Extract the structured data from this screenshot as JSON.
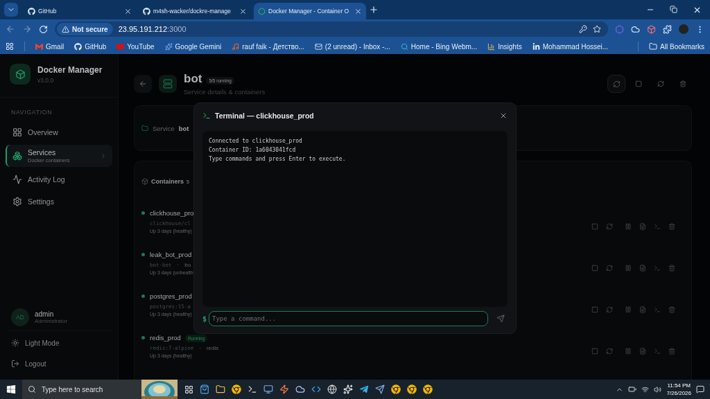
{
  "browser": {
    "tabs": [
      {
        "title": "GitHub",
        "selected": false
      },
      {
        "title": "m4sh-wacker/dockre-manage",
        "selected": false
      },
      {
        "title": "Docker Manager - Container O",
        "selected": true
      }
    ],
    "address": {
      "security": "Not secure",
      "host": "23.95.191.212",
      "port": ":3000"
    },
    "bookmarks": [
      "Gmail",
      "GitHub",
      "YouTube",
      "Google Gemini",
      "rauf faik - Детство...",
      "(2 unread) - Inbox -...",
      "Home - Bing Webm...",
      "Insights",
      "Mohammad Hossei..."
    ],
    "all_bookmarks": "All Bookmarks"
  },
  "sidebar": {
    "app_name": "Docker Manager",
    "version": "v3.0.0",
    "section": "NAVIGATION",
    "items": [
      {
        "label": "Overview",
        "selected": false
      },
      {
        "label": "Services",
        "sublabel": "Docker containers",
        "selected": true
      },
      {
        "label": "Activity Log",
        "selected": false
      },
      {
        "label": "Settings",
        "selected": false
      }
    ],
    "user": {
      "initials": "AD",
      "name": "admin",
      "role": "Administrator"
    },
    "theme_toggle": "Light Mode",
    "logout": "Logout"
  },
  "header": {
    "title": "bot",
    "badge": "5/5 running",
    "subtitle": "Service details & containers"
  },
  "service_card": {
    "label": "Service",
    "value": "bot"
  },
  "containers": {
    "title": "Containers",
    "count": "5",
    "rows": [
      {
        "name": "clickhouse_pro",
        "image": "clickhouse/cl",
        "uptime": "Up 3 days (healthy)"
      },
      {
        "name": "leak_bot_prod",
        "image": "bot-bot",
        "separator": "·",
        "service": "bo",
        "uptime": "Up 3 days (unhealth"
      },
      {
        "name": "postgres_prod",
        "image": "postgres:15-a",
        "uptime": "Up 3 days (healthy)"
      },
      {
        "name": "redis_prod",
        "badge": "Running",
        "image": "redis:7-alpine",
        "separator": "·",
        "service": "redis",
        "uptime": "Up 3 days (healthy)"
      }
    ]
  },
  "terminal": {
    "title": "Terminal — clickhouse_prod",
    "lines": [
      "Connected to clickhouse_prod",
      "Container ID: 1a6043041fcd",
      "Type commands and press Enter to execute."
    ],
    "prompt": "$",
    "placeholder": "Type a command..."
  },
  "taskbar": {
    "search_placeholder": "Type here to search",
    "time": "11:54 PM",
    "date": "7/26/2026"
  }
}
